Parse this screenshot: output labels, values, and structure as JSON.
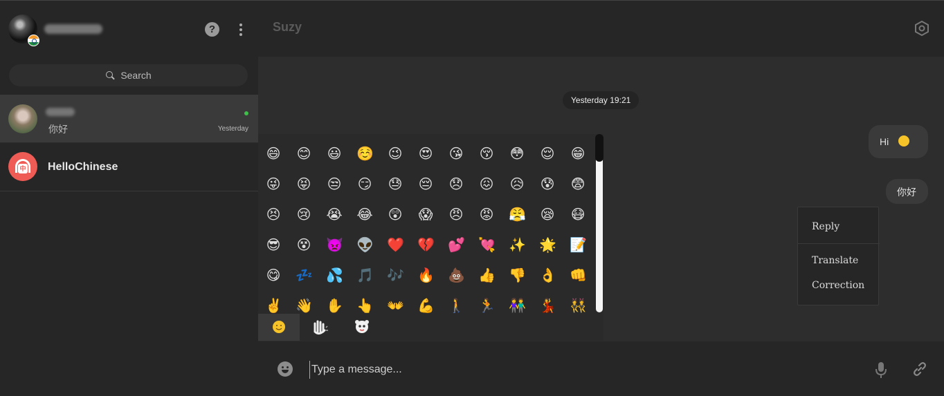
{
  "sidebar": {
    "search_label": "Search",
    "help_glyph": "?",
    "chats": [
      {
        "last_message": "你好",
        "time": "Yesterday",
        "online": true
      },
      {
        "name": "HelloChinese",
        "avatar_glyph": "中"
      }
    ]
  },
  "main": {
    "header_title": "Suzy",
    "date_divider": "Yesterday 19:21",
    "messages": [
      {
        "text": "Hi",
        "emoji": "slightly-smiling-face"
      },
      {
        "text": "你好"
      }
    ],
    "context_menu": [
      "Reply",
      "Translate",
      "Correction"
    ],
    "composer_placeholder": "Type a message..."
  },
  "emoji_panel": {
    "rows": [
      [
        "😄",
        "😊",
        "😃",
        "☺️",
        "😉",
        "😍",
        "😘",
        "😚",
        "😳",
        "😌",
        "😁"
      ],
      [
        "😜",
        "😝",
        "😒",
        "😏",
        "😓",
        "😔",
        "😞",
        "😖",
        "😥",
        "😰",
        "😨"
      ],
      [
        "😣",
        "😢",
        "😭",
        "😂",
        "😲",
        "😱",
        "😠",
        "😡",
        "😤",
        "😪",
        "😷"
      ],
      [
        "😎",
        "😵",
        "👿",
        "👽",
        "❤️",
        "💔",
        "💕",
        "💘",
        "✨",
        "🌟",
        "📝"
      ],
      [
        "😋",
        "💤",
        "💦",
        "🎵",
        "🎶",
        "🔥",
        "💩",
        "👍",
        "👎",
        "👌",
        "👊"
      ],
      [
        "✌️",
        "👋",
        "✋",
        "👆",
        "👐",
        "💪",
        "🚶",
        "🏃",
        "👫",
        "💃",
        "👯"
      ]
    ],
    "tabs": [
      "smiley-tab",
      "hand-tab",
      "face-tab"
    ],
    "active_tab": 0
  },
  "colors": {
    "accent_red": "#ef5b55",
    "online_green": "#3fbf4a",
    "emoji_yellow": "#f6c329"
  }
}
